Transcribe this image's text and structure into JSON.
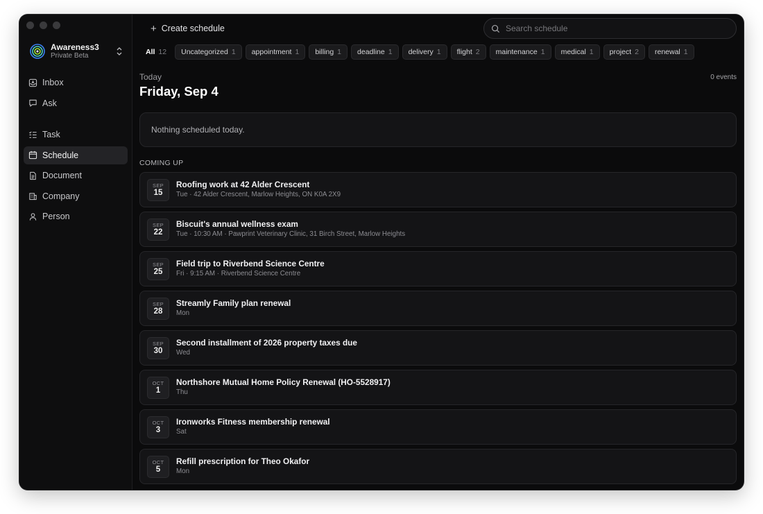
{
  "sidebar": {
    "workspace": {
      "name": "Awareness3",
      "subtitle": "Private Beta"
    },
    "nav_primary": [
      {
        "label": "Inbox",
        "icon": "inbox-icon"
      },
      {
        "label": "Ask",
        "icon": "chat-bubble-icon"
      }
    ],
    "nav_secondary": [
      {
        "label": "Task",
        "icon": "checklist-icon"
      },
      {
        "label": "Schedule",
        "icon": "calendar-icon",
        "active": true
      },
      {
        "label": "Document",
        "icon": "document-icon"
      },
      {
        "label": "Company",
        "icon": "building-icon"
      },
      {
        "label": "Person",
        "icon": "person-icon"
      }
    ]
  },
  "toolbar": {
    "create_label": "Create schedule",
    "search_placeholder": "Search schedule"
  },
  "filters": [
    {
      "label": "All",
      "count": "12",
      "active": true
    },
    {
      "label": "Uncategorized",
      "count": "1"
    },
    {
      "label": "appointment",
      "count": "1"
    },
    {
      "label": "billing",
      "count": "1"
    },
    {
      "label": "deadline",
      "count": "1"
    },
    {
      "label": "delivery",
      "count": "1"
    },
    {
      "label": "flight",
      "count": "2"
    },
    {
      "label": "maintenance",
      "count": "1"
    },
    {
      "label": "medical",
      "count": "1"
    },
    {
      "label": "project",
      "count": "2"
    },
    {
      "label": "renewal",
      "count": "1"
    }
  ],
  "today": {
    "label": "Today",
    "date": "Friday, Sep 4",
    "events_count": "0 events",
    "empty_message": "Nothing scheduled today."
  },
  "coming_up": {
    "label": "COMING UP",
    "events": [
      {
        "month": "SEP",
        "day": "15",
        "title": "Roofing work at 42 Alder Crescent",
        "subtitle": "Tue · 42 Alder Crescent, Marlow Heights, ON K0A 2X9"
      },
      {
        "month": "SEP",
        "day": "22",
        "title": "Biscuit's annual wellness exam",
        "subtitle": "Tue · 10:30 AM · Pawprint Veterinary Clinic, 31 Birch Street, Marlow Heights"
      },
      {
        "month": "SEP",
        "day": "25",
        "title": "Field trip to Riverbend Science Centre",
        "subtitle": "Fri · 9:15 AM · Riverbend Science Centre"
      },
      {
        "month": "SEP",
        "day": "28",
        "title": "Streamly Family plan renewal",
        "subtitle": "Mon"
      },
      {
        "month": "SEP",
        "day": "30",
        "title": "Second installment of 2026 property taxes due",
        "subtitle": "Wed"
      },
      {
        "month": "OCT",
        "day": "1",
        "title": "Northshore Mutual Home Policy Renewal (HO-5528917)",
        "subtitle": "Thu"
      },
      {
        "month": "OCT",
        "day": "3",
        "title": "Ironworks Fitness membership renewal",
        "subtitle": "Sat"
      },
      {
        "month": "OCT",
        "day": "5",
        "title": "Refill prescription for Theo Okafor",
        "subtitle": "Mon"
      }
    ]
  },
  "colors": {
    "window_bg": "#0b0b0c",
    "sidebar_bg": "#0e0e0f",
    "card_bg": "#141416",
    "active_nav_bg": "#232326",
    "logo_accent": "#4fd1c5"
  }
}
